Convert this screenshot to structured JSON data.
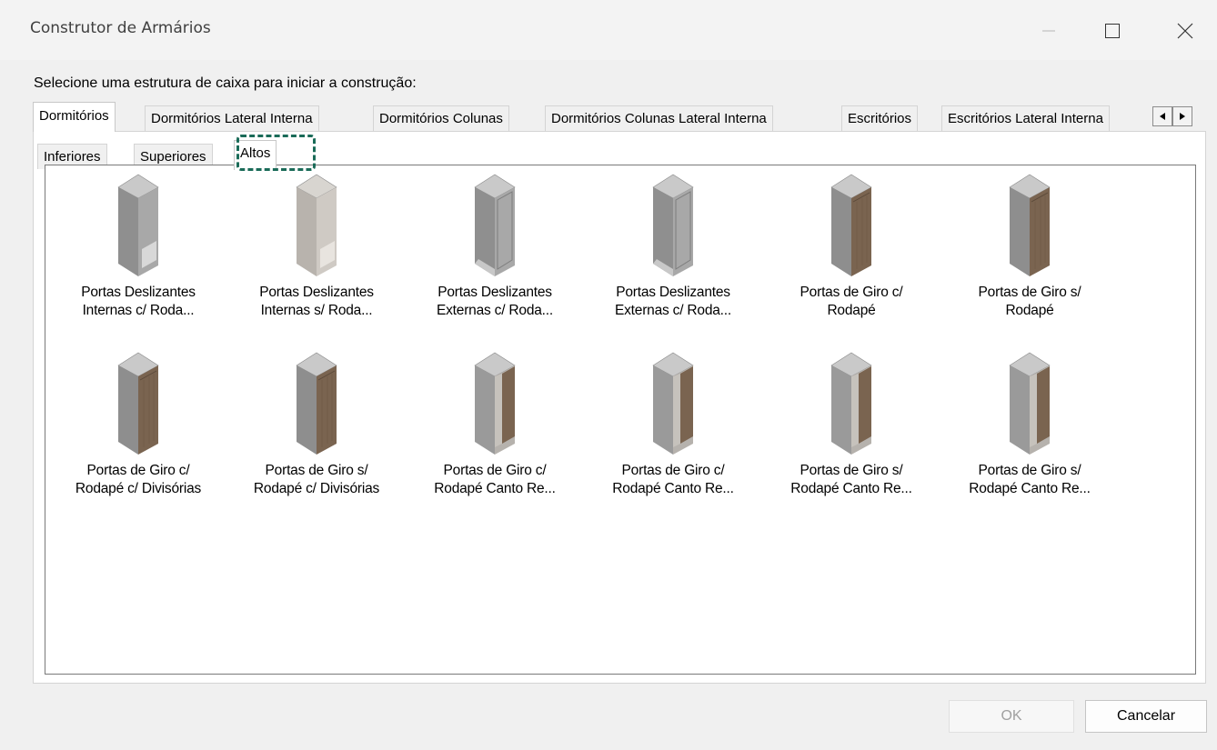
{
  "window": {
    "title": "Construtor de Armários"
  },
  "prompt": "Selecione uma estrutura de caixa para iniciar a construção:",
  "main_tabs": [
    {
      "label": "Dormitórios",
      "active": true
    },
    {
      "label": "Dormitórios Lateral Interna",
      "active": false
    },
    {
      "label": "Dormitórios Colunas",
      "active": false
    },
    {
      "label": "Dormitórios Colunas Lateral Interna",
      "active": false
    },
    {
      "label": "Escritórios",
      "active": false
    },
    {
      "label": "Escritórios Lateral Interna",
      "active": false
    }
  ],
  "sub_tabs": [
    {
      "label": "Inferiores",
      "active": false
    },
    {
      "label": "Superiores",
      "active": false
    },
    {
      "label": "Altos",
      "active": true
    }
  ],
  "items": [
    {
      "line1": "Portas Deslizantes",
      "line2": "Internas c/ Roda...",
      "icon": "cabinet-sliding-gray-icon"
    },
    {
      "line1": "Portas Deslizantes",
      "line2": "Internas s/ Roda...",
      "icon": "cabinet-sliding-light-icon"
    },
    {
      "line1": "Portas Deslizantes",
      "line2": "Externas c/ Roda...",
      "icon": "cabinet-sliding-external-icon"
    },
    {
      "line1": "Portas Deslizantes",
      "line2": "Externas c/ Roda...",
      "icon": "cabinet-sliding-external-icon"
    },
    {
      "line1": "Portas de Giro c/",
      "line2": "Rodapé",
      "icon": "cabinet-wood-door-icon"
    },
    {
      "line1": "Portas de Giro s/",
      "line2": "Rodapé",
      "icon": "cabinet-wood-door-icon"
    },
    {
      "line1": "Portas de Giro c/",
      "line2": "Rodapé c/ Divisórias",
      "icon": "cabinet-wood-door-icon"
    },
    {
      "line1": "Portas de Giro s/",
      "line2": "Rodapé c/ Divisórias",
      "icon": "cabinet-wood-door-icon"
    },
    {
      "line1": "Portas de Giro c/",
      "line2": "Rodapé Canto Re...",
      "icon": "cabinet-corner-icon"
    },
    {
      "line1": "Portas de Giro c/",
      "line2": "Rodapé Canto Re...",
      "icon": "cabinet-corner-icon"
    },
    {
      "line1": "Portas de Giro s/",
      "line2": "Rodapé Canto Re...",
      "icon": "cabinet-corner-icon"
    },
    {
      "line1": "Portas de Giro s/",
      "line2": "Rodapé Canto Re...",
      "icon": "cabinet-corner-icon"
    }
  ],
  "buttons": {
    "ok": "OK",
    "cancel": "Cancelar"
  },
  "colors": {
    "focus_ring": "#1a6b58",
    "wood": "#7a6450",
    "cabinet_gray": "#9c9c9c"
  }
}
